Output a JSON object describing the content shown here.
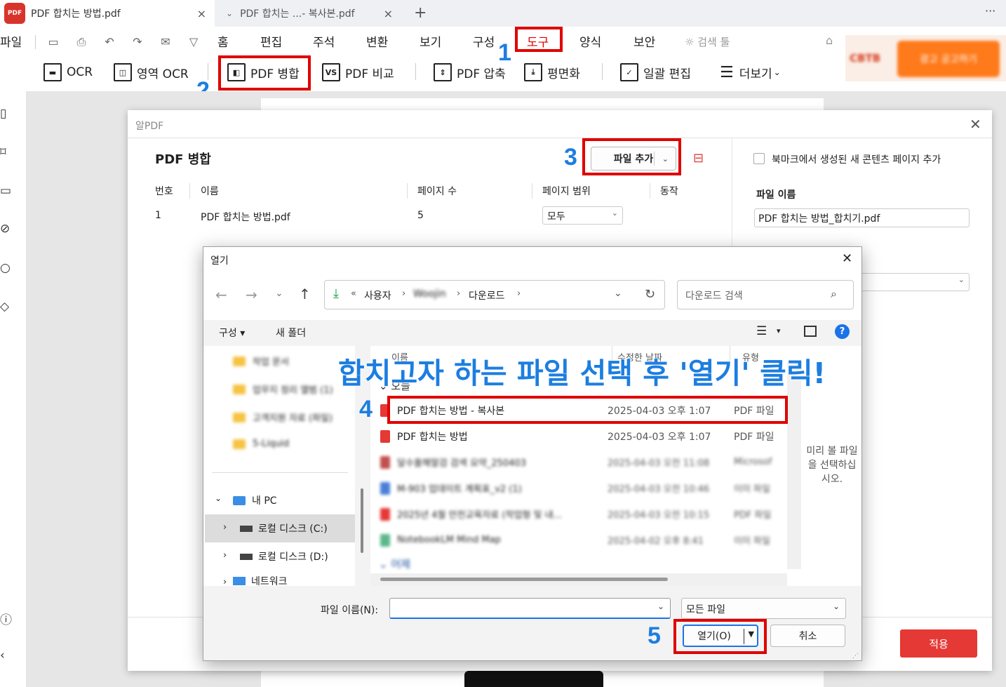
{
  "tabs": [
    {
      "title": "PDF 합치는 방법.pdf",
      "close": "×"
    },
    {
      "title": "PDF 합치는 ...- 복사본.pdf",
      "close": "×"
    }
  ],
  "tabbar": {
    "add": "+",
    "more": "···"
  },
  "menu": {
    "file": "파일",
    "items": [
      "홈",
      "편집",
      "주석",
      "변환",
      "보기",
      "구성",
      "도구",
      "양식",
      "보안"
    ],
    "search_tool": "검색 툴"
  },
  "toolbar": [
    "OCR",
    "영역 OCR",
    "PDF 병합",
    "PDF 비교",
    "PDF 압축",
    "평면화",
    "일괄 편집",
    "더보기"
  ],
  "toolbar_icons": {
    "compare": "VS"
  },
  "ad_banner": {
    "brand": "CBTB",
    "button": "광고 공고하기"
  },
  "steps": [
    "1",
    "2",
    "3",
    "4",
    "5"
  ],
  "annotation": "합치고자 하는 파일 선택 후 '열기' 클릭!",
  "merge_dialog": {
    "window_title": "알PDF",
    "title": "PDF 병합",
    "add_file": "파일 추가",
    "columns": [
      "번호",
      "이름",
      "페이지 수",
      "페이지 범위",
      "동작"
    ],
    "rows": [
      {
        "no": "1",
        "name": "PDF 합치는 방법.pdf",
        "pages": "5",
        "range": "모두"
      }
    ],
    "bookmark_option": "북마크에서 생성된 새 콘텐츠 페이지 추가",
    "filename_label": "파일 이름",
    "filename_value": "PDF 합치는 방법_합치기.pdf",
    "apply": "적용"
  },
  "open_dialog": {
    "title": "열기",
    "breadcrumb": [
      "«",
      "사용자",
      "Woojin",
      "다운로드"
    ],
    "search_placeholder": "다운로드 검색",
    "organize": "구성 ▾",
    "new_folder": "새 폴더",
    "columns": [
      "이름",
      "수정한 날짜",
      "유형"
    ],
    "group_today": "오늘",
    "group_earlier": "어제",
    "files": [
      {
        "name": "PDF 합치는 방법 - 복사본",
        "date": "2025-04-03 오후 1:07",
        "type": "PDF 파일"
      },
      {
        "name": "PDF 합치는 방법",
        "date": "2025-04-03 오후 1:07",
        "type": "PDF 파일"
      },
      {
        "name": "달수올해말검 검색 요약_250403",
        "date": "2025-04-03 오전 11:08",
        "type": "Microsof"
      },
      {
        "name": "M-903 업데이트 계획표_v2 (1)",
        "date": "2025-04-03 오전 10:46",
        "type": "이미 파일"
      },
      {
        "name": "2025년 4월 안전교육자료 (작업형 및 내...",
        "date": "2025-04-03 오전 10:15",
        "type": "PDF 파일"
      },
      {
        "name": "NotebookLM Mind Map",
        "date": "2025-04-02 오후 8:41",
        "type": "이미 파일"
      }
    ],
    "nav_folders": [
      "작업 문서",
      "업무지 정리 앨범 (1)",
      "고객지원 자료 (파일)",
      "5-Liquid"
    ],
    "nav_pc": "내 PC",
    "nav_drives": [
      "로컬 디스크 (C:)",
      "로컬 디스크 (D:)",
      "네트워크"
    ],
    "preview_text": "미리 볼 파일을 선택하십시오.",
    "filename_label": "파일 이름(N):",
    "filename_value": "",
    "filetype": "모든 파일",
    "open_button": "열기(O)",
    "cancel_button": "취소",
    "help": "?"
  }
}
